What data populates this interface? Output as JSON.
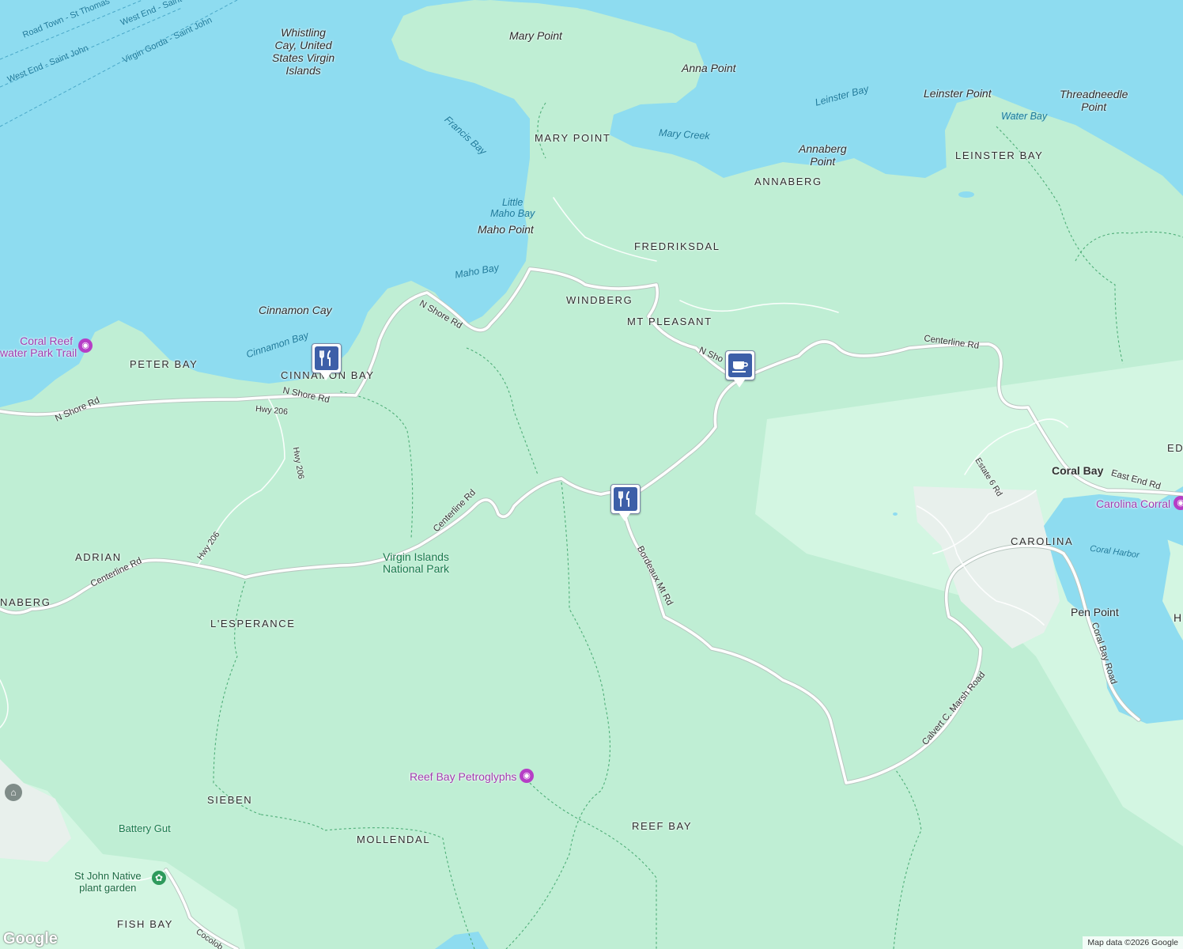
{
  "map": {
    "water_labels": [
      "Francis Bay",
      "Little\nMaho Bay",
      "Maho Bay",
      "Cinnamon Bay",
      "Mary Creek",
      "Leinster Bay",
      "Water Bay",
      "Coral Harbor"
    ],
    "ferry_routes": [
      "Road Town - St Thomas",
      "West End - Saint John",
      "West End - Saint",
      "Virgin Gorda - Saint John"
    ],
    "places": {
      "whistling_cay": "Whistling\nCay, United\nStates Virgin\nIslands",
      "mary_point": "Mary Point",
      "anna_point": "Anna Point",
      "leinster_point": "Leinster Point",
      "threadneedle_point": "Threadneedle\nPoint",
      "annaberg_point": "Annaberg\nPoint",
      "maho_point": "Maho Point",
      "cinnamon_cay": "Cinnamon Cay",
      "coral_bay": "Coral Bay",
      "pen_point": "Pen Point"
    },
    "neighborhoods": {
      "mary_point": "MARY POINT",
      "leinster_bay": "LEINSTER BAY",
      "annaberg": "ANNABERG",
      "fredriksdal": "FREDRIKSDAL",
      "windberg": "WINDBERG",
      "mt_pleasant": "MT PLEASANT",
      "peter_bay": "PETER BAY",
      "cinnamon_bay": "CINNAMON BAY",
      "adrian": "ADRIAN",
      "naberg": "NABERG",
      "lesperance": "L'ESPERANCE",
      "carolina": "CAROLINA",
      "sieben": "SIEBEN",
      "mollendal": "MOLLENDAL",
      "reef_bay": "REEF BAY",
      "fish_bay": "FISH BAY",
      "ed": "ED"
    },
    "roads": {
      "n_shore_a": "N Shore Rd",
      "n_shore_b": "N Shore Rd",
      "n_shore_c": "N Shore Rd",
      "n_shore_d": "N Sho",
      "hwy206_a": "Hwy 206",
      "hwy206_b": "Hwy 206",
      "hwy206_c": "Hwy 206",
      "centerline_a": "Centerline Rd",
      "centerline_b": "Centerline Rd",
      "centerline_c": "Centerline Rd",
      "bordeaux": "Bordeaux Mt Rd",
      "estate6": "Estate 6 Rd",
      "east_end": "East End Rd",
      "calvert": "Calvert C. Marsh Road",
      "coral_bay_road": "Coral Bay Road",
      "cocoloba": "Cocolob"
    },
    "parks": {
      "vinp": "Virgin Islands\nNational Park",
      "battery_gut": "Battery Gut",
      "st_john_garden": "St John Native\nplant garden"
    },
    "pois": {
      "coral_reef": "Coral Reef\nwater Park Trail",
      "reef_bay_petroglyphs": "Reef Bay Petroglyphs",
      "carolina_corral": "Carolina Corral",
      "h": "H"
    },
    "markers": [
      {
        "name": "restaurant",
        "icon": "fork-knife-icon"
      },
      {
        "name": "restaurant",
        "icon": "fork-knife-icon"
      },
      {
        "name": "cafe",
        "icon": "coffee-cup-icon"
      }
    ],
    "colors": {
      "land": "#bfeed4",
      "water": "#8edcf0",
      "urban": "#ecf0ee",
      "road": "#ffffff",
      "marker": "#3d5fa8"
    },
    "attribution": "Map data ©2026 Google",
    "logo": "Google"
  }
}
